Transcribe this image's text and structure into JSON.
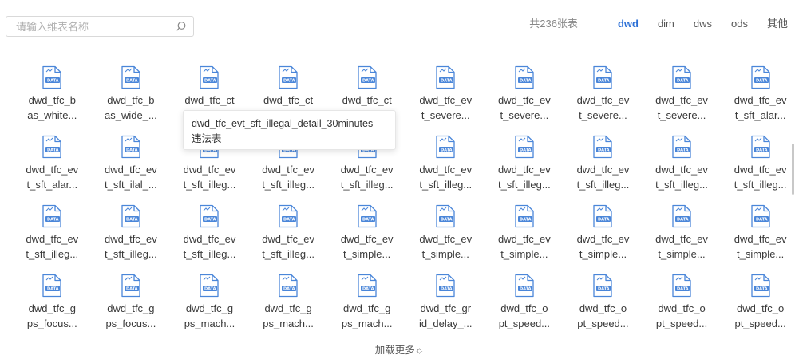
{
  "search": {
    "placeholder": "请输入维表名称",
    "value": ""
  },
  "header": {
    "count": "共236张表",
    "tabs": [
      {
        "label": "dwd",
        "active": true
      },
      {
        "label": "dim",
        "active": false
      },
      {
        "label": "dws",
        "active": false
      },
      {
        "label": "ods",
        "active": false
      },
      {
        "label": "其他",
        "active": false
      }
    ]
  },
  "icons": {
    "file": "data-file-icon",
    "search": "search-icon"
  },
  "colors": {
    "accent": "#2b6fd6",
    "icon": "#4a86d9"
  },
  "files": [
    [
      "dwd_tfc_b",
      "as_white..."
    ],
    [
      "dwd_tfc_b",
      "as_wide_..."
    ],
    [
      "dwd_tfc_ct",
      ""
    ],
    [
      "dwd_tfc_ct",
      ""
    ],
    [
      "dwd_tfc_ct",
      ""
    ],
    [
      "dwd_tfc_ev",
      "t_severe..."
    ],
    [
      "dwd_tfc_ev",
      "t_severe..."
    ],
    [
      "dwd_tfc_ev",
      "t_severe..."
    ],
    [
      "dwd_tfc_ev",
      "t_severe..."
    ],
    [
      "dwd_tfc_ev",
      "t_sft_alar..."
    ],
    [
      "dwd_tfc_ev",
      "t_sft_alar..."
    ],
    [
      "dwd_tfc_ev",
      "t_sft_ilal_..."
    ],
    [
      "dwd_tfc_ev",
      "t_sft_illeg..."
    ],
    [
      "dwd_tfc_ev",
      "t_sft_illeg..."
    ],
    [
      "dwd_tfc_ev",
      "t_sft_illeg..."
    ],
    [
      "dwd_tfc_ev",
      "t_sft_illeg..."
    ],
    [
      "dwd_tfc_ev",
      "t_sft_illeg..."
    ],
    [
      "dwd_tfc_ev",
      "t_sft_illeg..."
    ],
    [
      "dwd_tfc_ev",
      "t_sft_illeg..."
    ],
    [
      "dwd_tfc_ev",
      "t_sft_illeg..."
    ],
    [
      "dwd_tfc_ev",
      "t_sft_illeg..."
    ],
    [
      "dwd_tfc_ev",
      "t_sft_illeg..."
    ],
    [
      "dwd_tfc_ev",
      "t_sft_illeg..."
    ],
    [
      "dwd_tfc_ev",
      "t_sft_illeg..."
    ],
    [
      "dwd_tfc_ev",
      "t_simple..."
    ],
    [
      "dwd_tfc_ev",
      "t_simple..."
    ],
    [
      "dwd_tfc_ev",
      "t_simple..."
    ],
    [
      "dwd_tfc_ev",
      "t_simple..."
    ],
    [
      "dwd_tfc_ev",
      "t_simple..."
    ],
    [
      "dwd_tfc_ev",
      "t_simple..."
    ],
    [
      "dwd_tfc_g",
      "ps_focus..."
    ],
    [
      "dwd_tfc_g",
      "ps_focus..."
    ],
    [
      "dwd_tfc_g",
      "ps_mach..."
    ],
    [
      "dwd_tfc_g",
      "ps_mach..."
    ],
    [
      "dwd_tfc_g",
      "ps_mach..."
    ],
    [
      "dwd_tfc_gr",
      "id_delay_..."
    ],
    [
      "dwd_tfc_o",
      "pt_speed..."
    ],
    [
      "dwd_tfc_o",
      "pt_speed..."
    ],
    [
      "dwd_tfc_o",
      "pt_speed..."
    ],
    [
      "dwd_tfc_o",
      "pt_speed..."
    ]
  ],
  "tooltip": {
    "line1": "dwd_tfc_evt_sft_illegal_detail_30minutes",
    "line2": "违法表"
  },
  "load_more": "加载更多☼"
}
